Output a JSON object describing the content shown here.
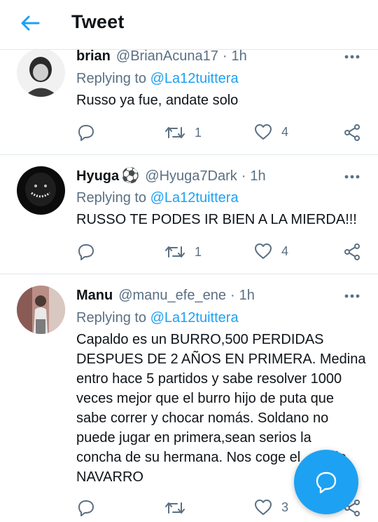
{
  "header": {
    "title": "Tweet"
  },
  "tweets": [
    {
      "name": "brian",
      "emoji": "",
      "handle": "@BrianAcuna17",
      "sep": "·",
      "time": "1h",
      "replying_label": "Replying to",
      "replying_to": "@La12tuittera",
      "text": "Russo ya fue, andate solo",
      "retweets": "1",
      "likes": "4"
    },
    {
      "name": "Hyuga",
      "emoji": "⚽",
      "handle": "@Hyuga7Dark",
      "sep": "·",
      "time": "1h",
      "replying_label": "Replying to",
      "replying_to": "@La12tuittera",
      "text": "RUSSO TE PODES IR BIEN A LA MIERDA!!!",
      "retweets": "1",
      "likes": "4"
    },
    {
      "name": "Manu",
      "emoji": "",
      "handle": "@manu_efe_ene",
      "sep": "·",
      "time": "1h",
      "replying_label": "Replying to",
      "replying_to": "@La12tuittera",
      "text_lines": [
        "Capaldo es un BURRO,500 PERDIDAS",
        "DESPUES DE 2 AÑOS EN PRIMERA. Medina",
        "entro hace 5 partidos y sabe resolver 1000",
        "veces mejor que el burro hijo de puta que",
        "sabe correr y chocar nomás. Soldano no",
        "puede jugar en primera,sean serios la",
        "concha de su hermana. Nos coge el        tio",
        "NAVARRO"
      ],
      "retweets": "",
      "likes": "3"
    }
  ],
  "icons": {
    "back": "arrow-left-icon",
    "more": "more-dots-icon",
    "reply": "reply-bubble-icon",
    "retweet": "retweet-icon",
    "like": "heart-icon",
    "share": "share-icon",
    "compose": "compose-reply-icon"
  },
  "colors": {
    "accent": "#1da1f2",
    "text": "#0f1419",
    "muted": "#5b7083",
    "divider": "#e1e8ed"
  }
}
